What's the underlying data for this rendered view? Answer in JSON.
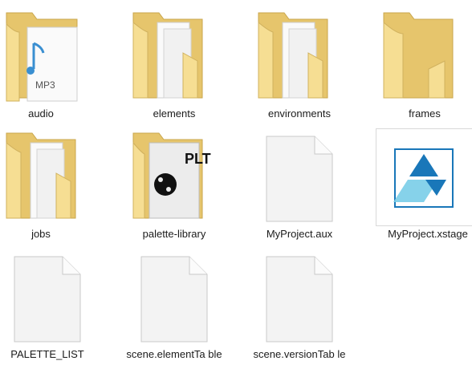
{
  "colors": {
    "folder_back": "#e6c56c",
    "folder_front": "#f6de93",
    "file_fill": "#f3f3f3",
    "file_border": "#c9c9c9",
    "app_blue": "#1977b9",
    "app_light": "#79cde8"
  },
  "items": [
    {
      "label": "audio",
      "icon": "folder-mp3-icon"
    },
    {
      "label": "elements",
      "icon": "folder-documents-icon"
    },
    {
      "label": "environments",
      "icon": "folder-documents-icon"
    },
    {
      "label": "frames",
      "icon": "folder-empty-icon"
    },
    {
      "label": "jobs",
      "icon": "folder-documents-icon"
    },
    {
      "label": "palette-library",
      "icon": "folder-plt-icon"
    },
    {
      "label": "MyProject.aux",
      "icon": "blank-file-icon"
    },
    {
      "label": "MyProject.xstage",
      "icon": "toonboom-xstage-icon"
    },
    {
      "label": "PALETTE_LIST",
      "icon": "blank-file-icon"
    },
    {
      "label": "scene.elementTa ble",
      "icon": "blank-file-icon"
    },
    {
      "label": "scene.versionTab le",
      "icon": "blank-file-icon"
    }
  ],
  "mp3_text": "MP3",
  "plt_text": "PLT"
}
